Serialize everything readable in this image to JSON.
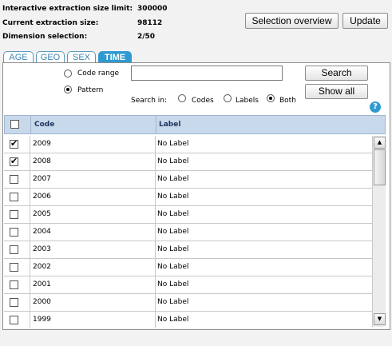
{
  "info": {
    "size_limit_label": "Interactive extraction size limit:",
    "size_limit_value": "300000",
    "current_size_label": "Current extraction size:",
    "current_size_value": "98112",
    "dimension_label": "Dimension selection:",
    "dimension_value": "2/50"
  },
  "toolbar": {
    "selection_overview": "Selection overview",
    "update": "Update"
  },
  "tabs": [
    {
      "label": "AGE",
      "active": false
    },
    {
      "label": "GEO",
      "active": false
    },
    {
      "label": "SEX",
      "active": false
    },
    {
      "label": "TIME",
      "active": true
    }
  ],
  "search": {
    "code_range_label": "Code range",
    "pattern_label": "Pattern",
    "mode_selected": "Pattern",
    "input_value": "",
    "search_button": "Search",
    "show_all_button": "Show all",
    "search_in_label": "Search in:",
    "search_in_options": [
      "Codes",
      "Labels",
      "Both"
    ],
    "search_in_selected": "Both",
    "help": "?"
  },
  "table": {
    "columns": [
      "Code",
      "Label"
    ],
    "rows": [
      {
        "code": "2009",
        "label": "No Label",
        "checked": true
      },
      {
        "code": "2008",
        "label": "No Label",
        "checked": true
      },
      {
        "code": "2007",
        "label": "No Label",
        "checked": false
      },
      {
        "code": "2006",
        "label": "No Label",
        "checked": false
      },
      {
        "code": "2005",
        "label": "No Label",
        "checked": false
      },
      {
        "code": "2004",
        "label": "No Label",
        "checked": false
      },
      {
        "code": "2003",
        "label": "No Label",
        "checked": false
      },
      {
        "code": "2002",
        "label": "No Label",
        "checked": false
      },
      {
        "code": "2001",
        "label": "No Label",
        "checked": false
      },
      {
        "code": "2000",
        "label": "No Label",
        "checked": false
      },
      {
        "code": "1999",
        "label": "No Label",
        "checked": false
      }
    ]
  },
  "colors": {
    "tab_active": "#2f9ad0",
    "header_bg": "#c9d9ec",
    "page_bg": "#f2f2f2"
  }
}
